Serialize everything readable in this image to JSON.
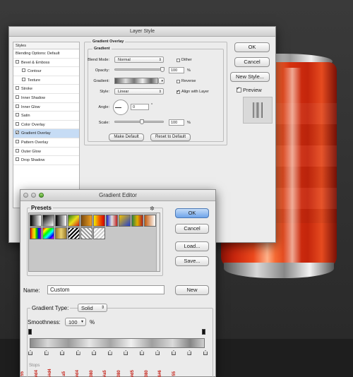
{
  "layer_style": {
    "title": "Layer Style",
    "styles_header": "Styles",
    "style_items": [
      {
        "label": "Blending Options: Default",
        "checkbox": false,
        "checked": false,
        "sub": false,
        "selected": false
      },
      {
        "label": "Bevel & Emboss",
        "checkbox": true,
        "checked": false,
        "sub": false,
        "selected": false
      },
      {
        "label": "Contour",
        "checkbox": true,
        "checked": false,
        "sub": true,
        "selected": false
      },
      {
        "label": "Texture",
        "checkbox": true,
        "checked": false,
        "sub": true,
        "selected": false
      },
      {
        "label": "Stroke",
        "checkbox": true,
        "checked": false,
        "sub": false,
        "selected": false
      },
      {
        "label": "Inner Shadow",
        "checkbox": true,
        "checked": false,
        "sub": false,
        "selected": false
      },
      {
        "label": "Inner Glow",
        "checkbox": true,
        "checked": false,
        "sub": false,
        "selected": false
      },
      {
        "label": "Satin",
        "checkbox": true,
        "checked": false,
        "sub": false,
        "selected": false
      },
      {
        "label": "Color Overlay",
        "checkbox": true,
        "checked": false,
        "sub": false,
        "selected": false
      },
      {
        "label": "Gradient Overlay",
        "checkbox": true,
        "checked": true,
        "sub": false,
        "selected": true
      },
      {
        "label": "Pattern Overlay",
        "checkbox": true,
        "checked": false,
        "sub": false,
        "selected": false
      },
      {
        "label": "Outer Glow",
        "checkbox": true,
        "checked": false,
        "sub": false,
        "selected": false
      },
      {
        "label": "Drop Shadow",
        "checkbox": true,
        "checked": false,
        "sub": false,
        "selected": false
      }
    ],
    "section_title": "Gradient Overlay",
    "subsection_title": "Gradient",
    "blend_mode_label": "Blend Mode:",
    "blend_mode_value": "Normal",
    "dither_label": "Dither",
    "dither_checked": false,
    "opacity_label": "Opacity:",
    "opacity_value": "100",
    "opacity_unit": "%",
    "opacity_level": 1.0,
    "gradient_label": "Gradient:",
    "reverse_label": "Reverse",
    "reverse_checked": false,
    "style_label": "Style:",
    "style_value": "Linear",
    "align_label": "Align with Layer",
    "align_checked": true,
    "angle_label": "Angle:",
    "angle_value": "0",
    "angle_unit": "°",
    "scale_label": "Scale:",
    "scale_value": "100",
    "scale_unit": "%",
    "scale_level": 0.55,
    "make_default": "Make Default",
    "reset_default": "Reset to Default",
    "ok": "OK",
    "cancel": "Cancel",
    "new_style": "New Style...",
    "preview_label": "Preview",
    "preview_checked": true
  },
  "gradient_editor": {
    "title": "Gradient Editor",
    "presets_label": "Presets",
    "gear_icon": "gear-icon",
    "ok": "OK",
    "cancel": "Cancel",
    "load": "Load...",
    "save": "Save...",
    "name_label": "Name:",
    "name_value": "Custom",
    "new_button": "New",
    "gradient_type_label": "Gradient Type:",
    "gradient_type_value": "Solid",
    "smoothness_label": "Smoothness:",
    "smoothness_value": "100",
    "smoothness_unit": "%",
    "stops_label": "Stops",
    "hex_labels": [
      "55",
      "#d4",
      "5#d4",
      "a5",
      "#d4",
      "080",
      "#a5",
      "080",
      "#d5",
      "080",
      "6#6",
      "55"
    ]
  },
  "presets": [
    "linear-gradient(90deg,#000,#fff)",
    "linear-gradient(135deg,#000,#fff)",
    "linear-gradient(90deg,#000,#fff)",
    "linear-gradient(135deg,#2a7a1a,#e8e01a,#d01a1a)",
    "linear-gradient(90deg,#7a4a10,#f0a020)",
    "linear-gradient(90deg,#f0f000,#f06000,#d00000)",
    "linear-gradient(90deg,#2020c0,#e0e0e0,#c02020)",
    "linear-gradient(135deg,#f0c000,#2040d0)",
    "linear-gradient(90deg,#2a8040,#e0b000,#b02020)",
    "linear-gradient(90deg,#c05a10,#ffffff)",
    "linear-gradient(90deg,#d00000,#f0a000,#f0f000,#00c000,#0000f0,#a000c0)",
    "linear-gradient(135deg,#f00,#ff0,#0f0,#0ff,#00f,#f0f)",
    "linear-gradient(90deg,#9a7a2a,#e8d070,#9a7a2a)",
    "repeating-linear-gradient(135deg,#000 0 2px,#fff 2px 4px)",
    "repeating-linear-gradient(45deg,#999 0 2px,#fff 2px 4px)",
    "repeating-linear-gradient(135deg,#ccc 0 2px,#fff 2px 4px)"
  ]
}
